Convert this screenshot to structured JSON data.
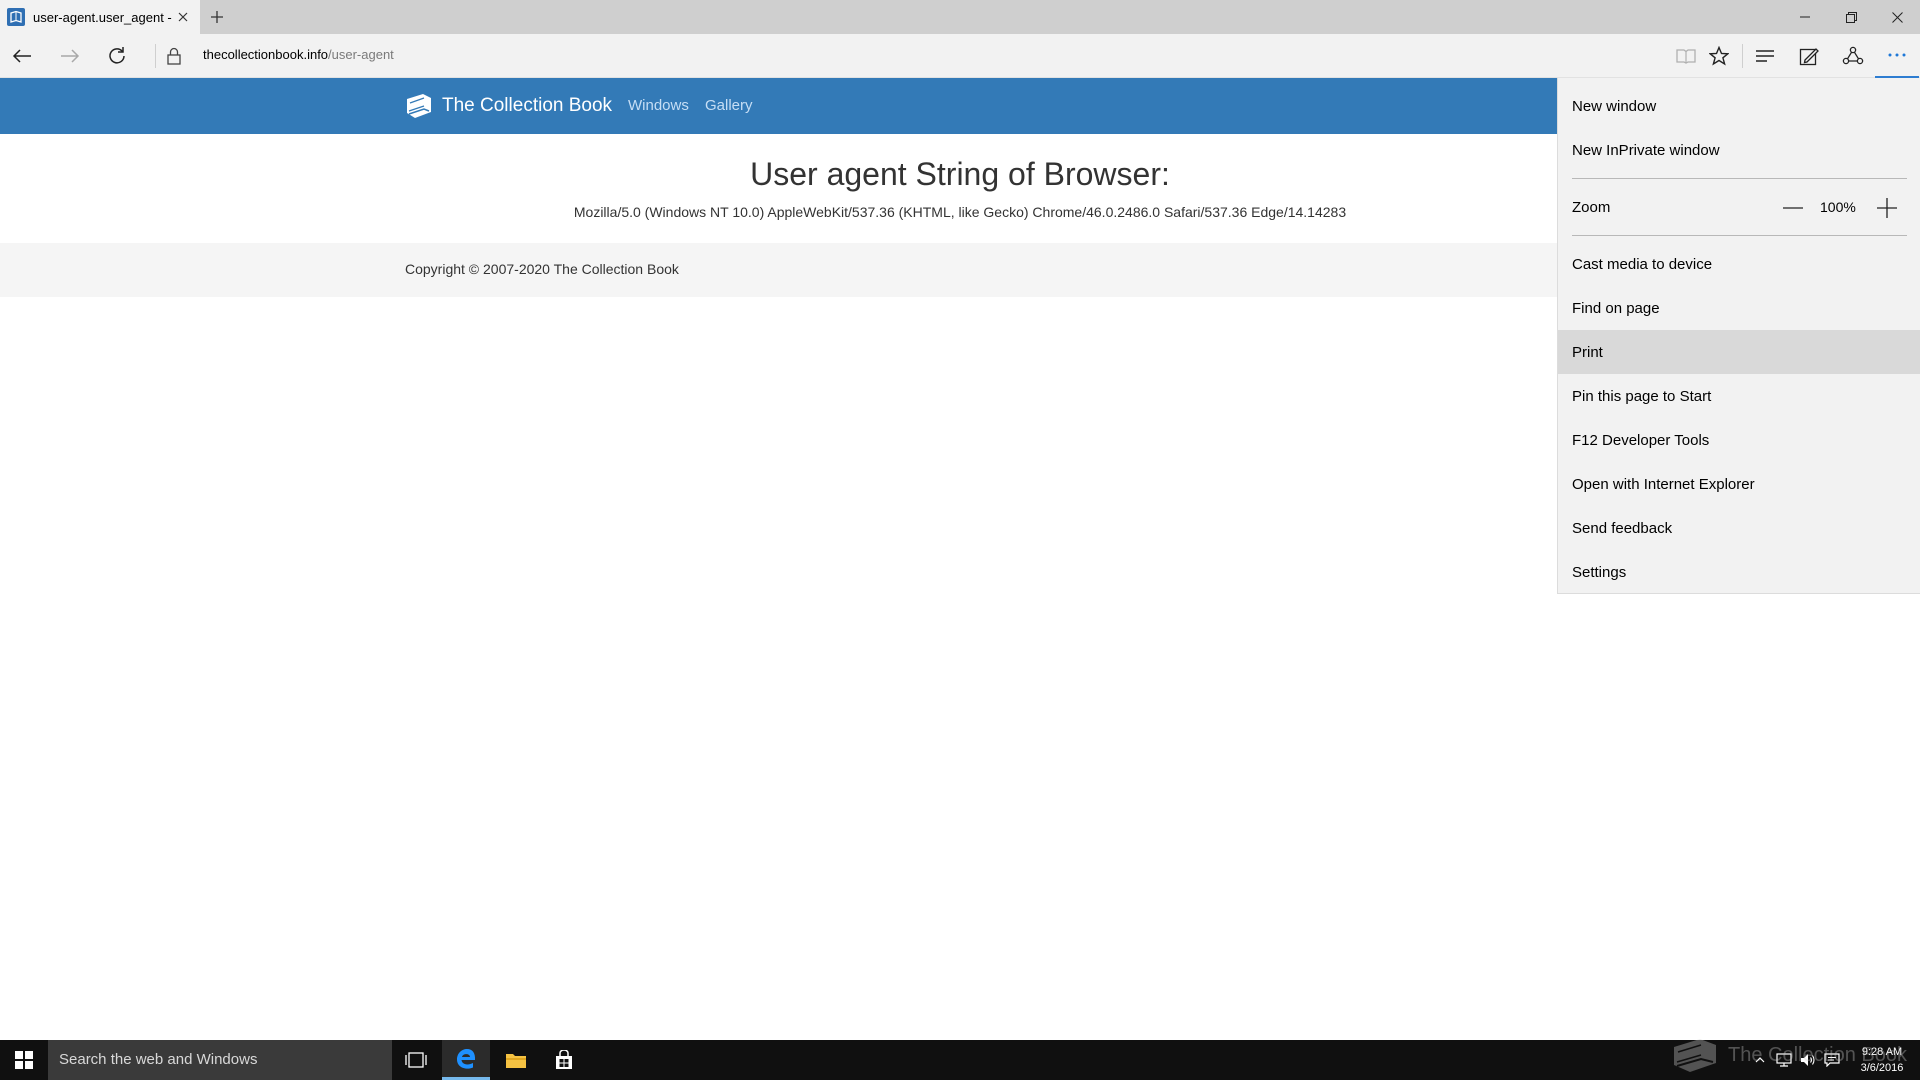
{
  "browser": {
    "tab": {
      "title": "user-agent.user_agent -",
      "favicon": "book-icon"
    },
    "address": {
      "domain": "thecollectionbook.info",
      "path": "/user-agent"
    }
  },
  "page": {
    "brand": "The Collection Book",
    "nav": [
      "Windows",
      "Gallery"
    ],
    "heading": "User agent String of Browser:",
    "user_agent": "Mozilla/5.0 (Windows NT 10.0) AppleWebKit/537.36 (KHTML, like Gecko) Chrome/46.0.2486.0 Safari/537.36 Edge/14.14283",
    "copyright": "Copyright © 2007-2020 The Collection Book",
    "header_color": "#337ab7"
  },
  "menu": {
    "new_window": "New window",
    "new_inprivate": "New InPrivate window",
    "zoom_label": "Zoom",
    "zoom_value": "100%",
    "cast": "Cast media to device",
    "find": "Find on page",
    "print": "Print",
    "pin": "Pin this page to Start",
    "devtools": "F12 Developer Tools",
    "open_ie": "Open with Internet Explorer",
    "feedback": "Send feedback",
    "settings": "Settings"
  },
  "taskbar": {
    "search_placeholder": "Search the web and Windows",
    "time": "9:28 AM",
    "date": "3/6/2016",
    "watermark": "The Collection Book"
  },
  "colors": {
    "accent": "#2e7dd1",
    "edge_blue": "#1e78d7"
  }
}
